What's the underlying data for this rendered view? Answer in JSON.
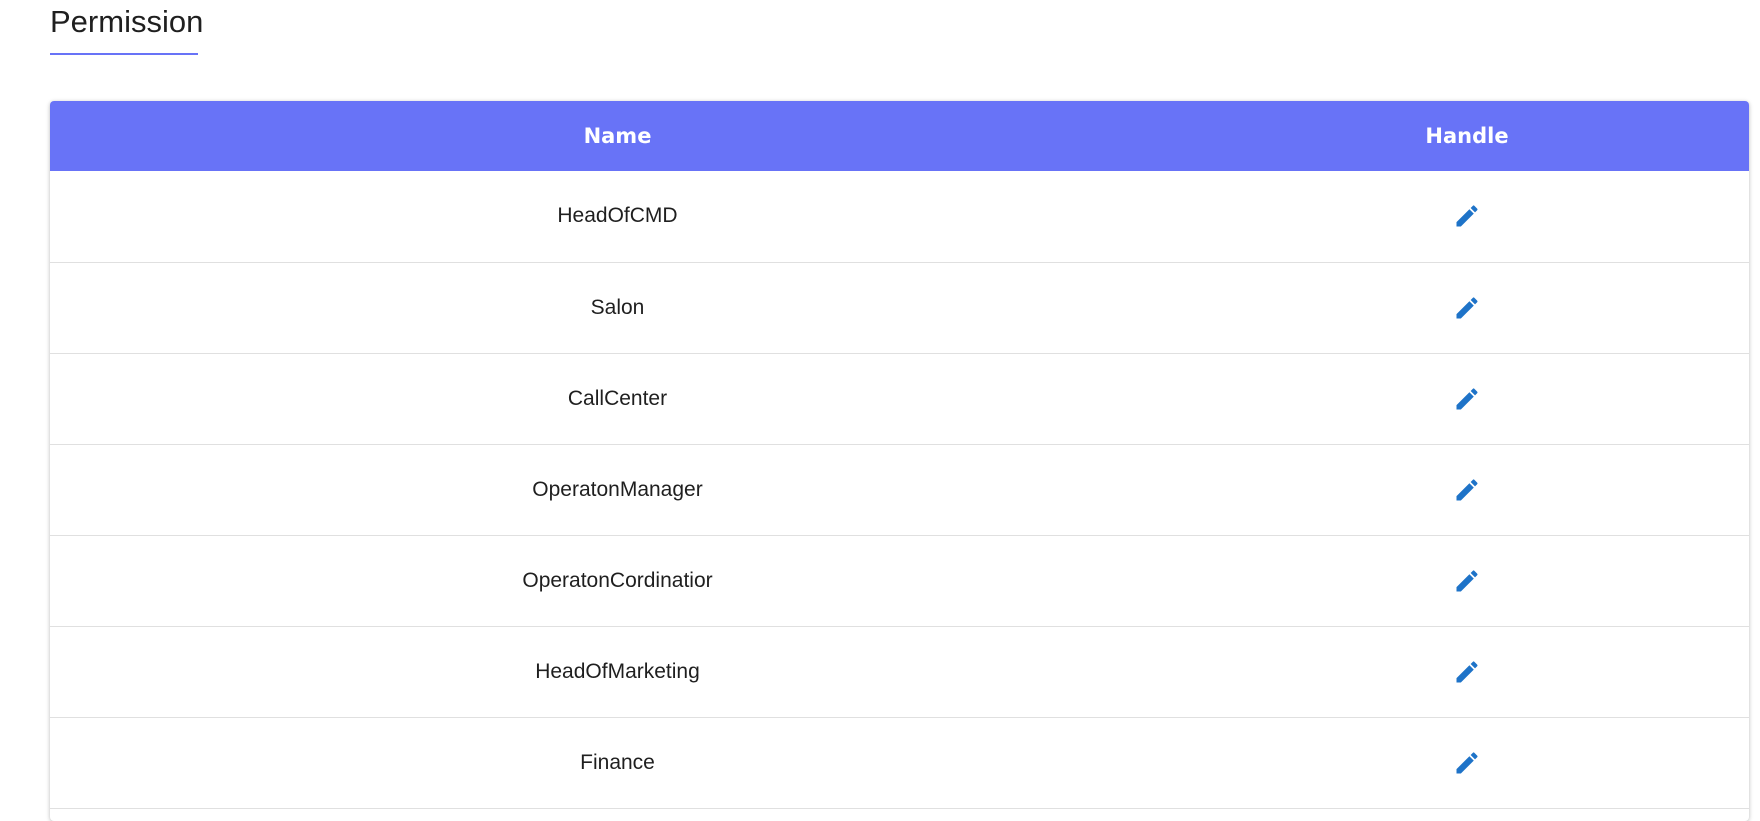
{
  "page": {
    "title": "Permission"
  },
  "table": {
    "columns": [
      "Name",
      "Handle"
    ],
    "rows": [
      {
        "name": "HeadOfCMD",
        "action_icon": "edit-pencil-icon"
      },
      {
        "name": "Salon",
        "action_icon": "edit-pencil-icon"
      },
      {
        "name": "CallCenter",
        "action_icon": "edit-pencil-icon"
      },
      {
        "name": "OperatonManager",
        "action_icon": "edit-pencil-icon"
      },
      {
        "name": "OperatonCordinatior",
        "action_icon": "edit-pencil-icon"
      },
      {
        "name": "HeadOfMarketing",
        "action_icon": "edit-pencil-icon"
      },
      {
        "name": "Finance",
        "action_icon": "edit-pencil-icon"
      }
    ]
  },
  "colors": {
    "accent": "#6873f7",
    "edit_icon": "#1e73c8",
    "row_divider": "#e0e0e0"
  }
}
